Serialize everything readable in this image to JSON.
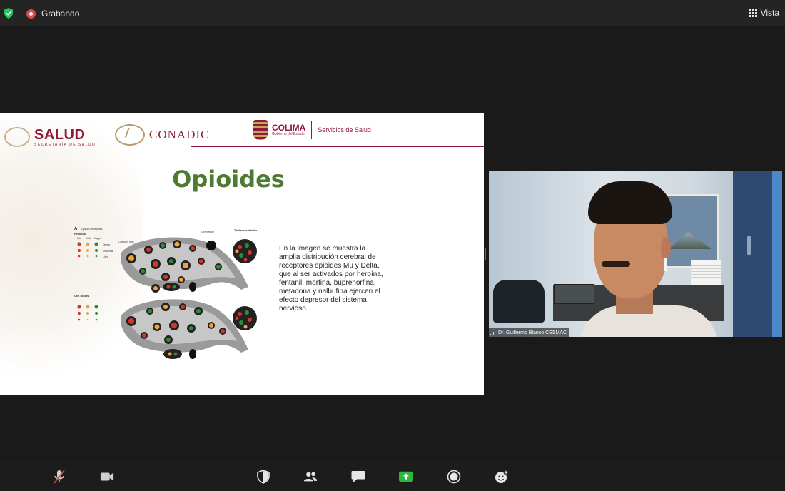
{
  "topbar": {
    "recording_label": "Grabando",
    "view_label": "Vista",
    "security_icon": "shield-check-icon",
    "view_icon": "grid-icon"
  },
  "slide": {
    "logos": {
      "salud": "SALUD",
      "salud_sub": "SECRETARÍA DE SALUD",
      "conadic": "CONADIC",
      "colima": "COLIMA",
      "colima_sub": "Gobierno del Estado",
      "services": "Servicios de Salud"
    },
    "title": "Opioides",
    "figure": {
      "panel_a": "A",
      "panel_a_title": "Opioid receptors",
      "proteins": "Proteins",
      "cell_bodies": "Cell bodies",
      "columns": [
        "Mu",
        "Delta",
        "Kappa"
      ],
      "densities": [
        "Dense",
        "Moderate",
        "Light"
      ],
      "thalamus": "Thalamus details",
      "olfactory": "Olfactory bulb",
      "cerebellum": "Cerebellum"
    },
    "caption": "En la imagen se muestra la amplia distribución cerebral de receptores opioides Mu y Delta, que al ser activados por heroína, fentanil, morfina, buprenorfina, metadona y nalbufina ejercen el efecto depresor del sistema nervioso."
  },
  "video": {
    "participant_name": "Dr. Guillermo Blanco CESMAC"
  },
  "toolbar": {
    "icons": [
      "microphone-muted-icon",
      "video-camera-icon",
      "security-shield-icon",
      "participants-icon",
      "chat-icon",
      "share-screen-icon",
      "record-icon",
      "reactions-icon"
    ]
  },
  "colors": {
    "topbar_bg": "#242424",
    "body_bg": "#1a1a1a",
    "recording_red": "#e0494b",
    "shield_green": "#22c55e",
    "share_green": "#2eb83b",
    "salud_maroon": "#8e1b3a",
    "title_green": "#4f7a32"
  }
}
